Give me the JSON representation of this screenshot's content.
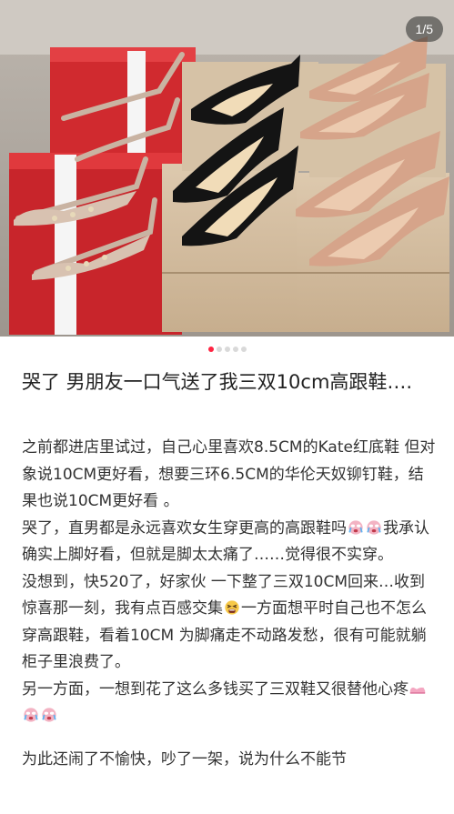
{
  "image_counter": "1/5",
  "carousel": {
    "total": 5,
    "active_index": 0
  },
  "post": {
    "title": "哭了 男朋友一口气送了我三双10cm高跟鞋….",
    "p1": "之前都进店里试过，自己心里喜欢8.5CM的Kate红底鞋 但对象说10CM更好看，想要三环6.5CM的华伦天奴铆钉鞋，结果也说10CM更好看 。",
    "p2a": "哭了，直男都是永远喜欢女生穿更高的高跟鞋吗",
    "p2b": "我承认确实上脚好看，但就是脚太太痛了……觉得很不实穿。",
    "p3a": "没想到，快520了，好家伙 一下整了三双10CM回来…收到惊喜那一刻，我有点百感交集",
    "p3b": "一方面想平时自己也不怎么穿高跟鞋，看着10CM 为脚痛走不动路发愁，很有可能就躺柜子里浪费了。",
    "p4": "另一方面，一想到花了这么多钱买了三双鞋又很替他心疼",
    "p5": "为此还闹了不愉快，吵了一架，说为什么不能节"
  },
  "icons": {
    "crying_face": "crying-face-icon",
    "tired_face": "tired-face-icon",
    "pink_shoe": "pink-shoe-icon"
  },
  "colors": {
    "accent": "#ff2442",
    "text": "#333333",
    "title": "#222222"
  }
}
